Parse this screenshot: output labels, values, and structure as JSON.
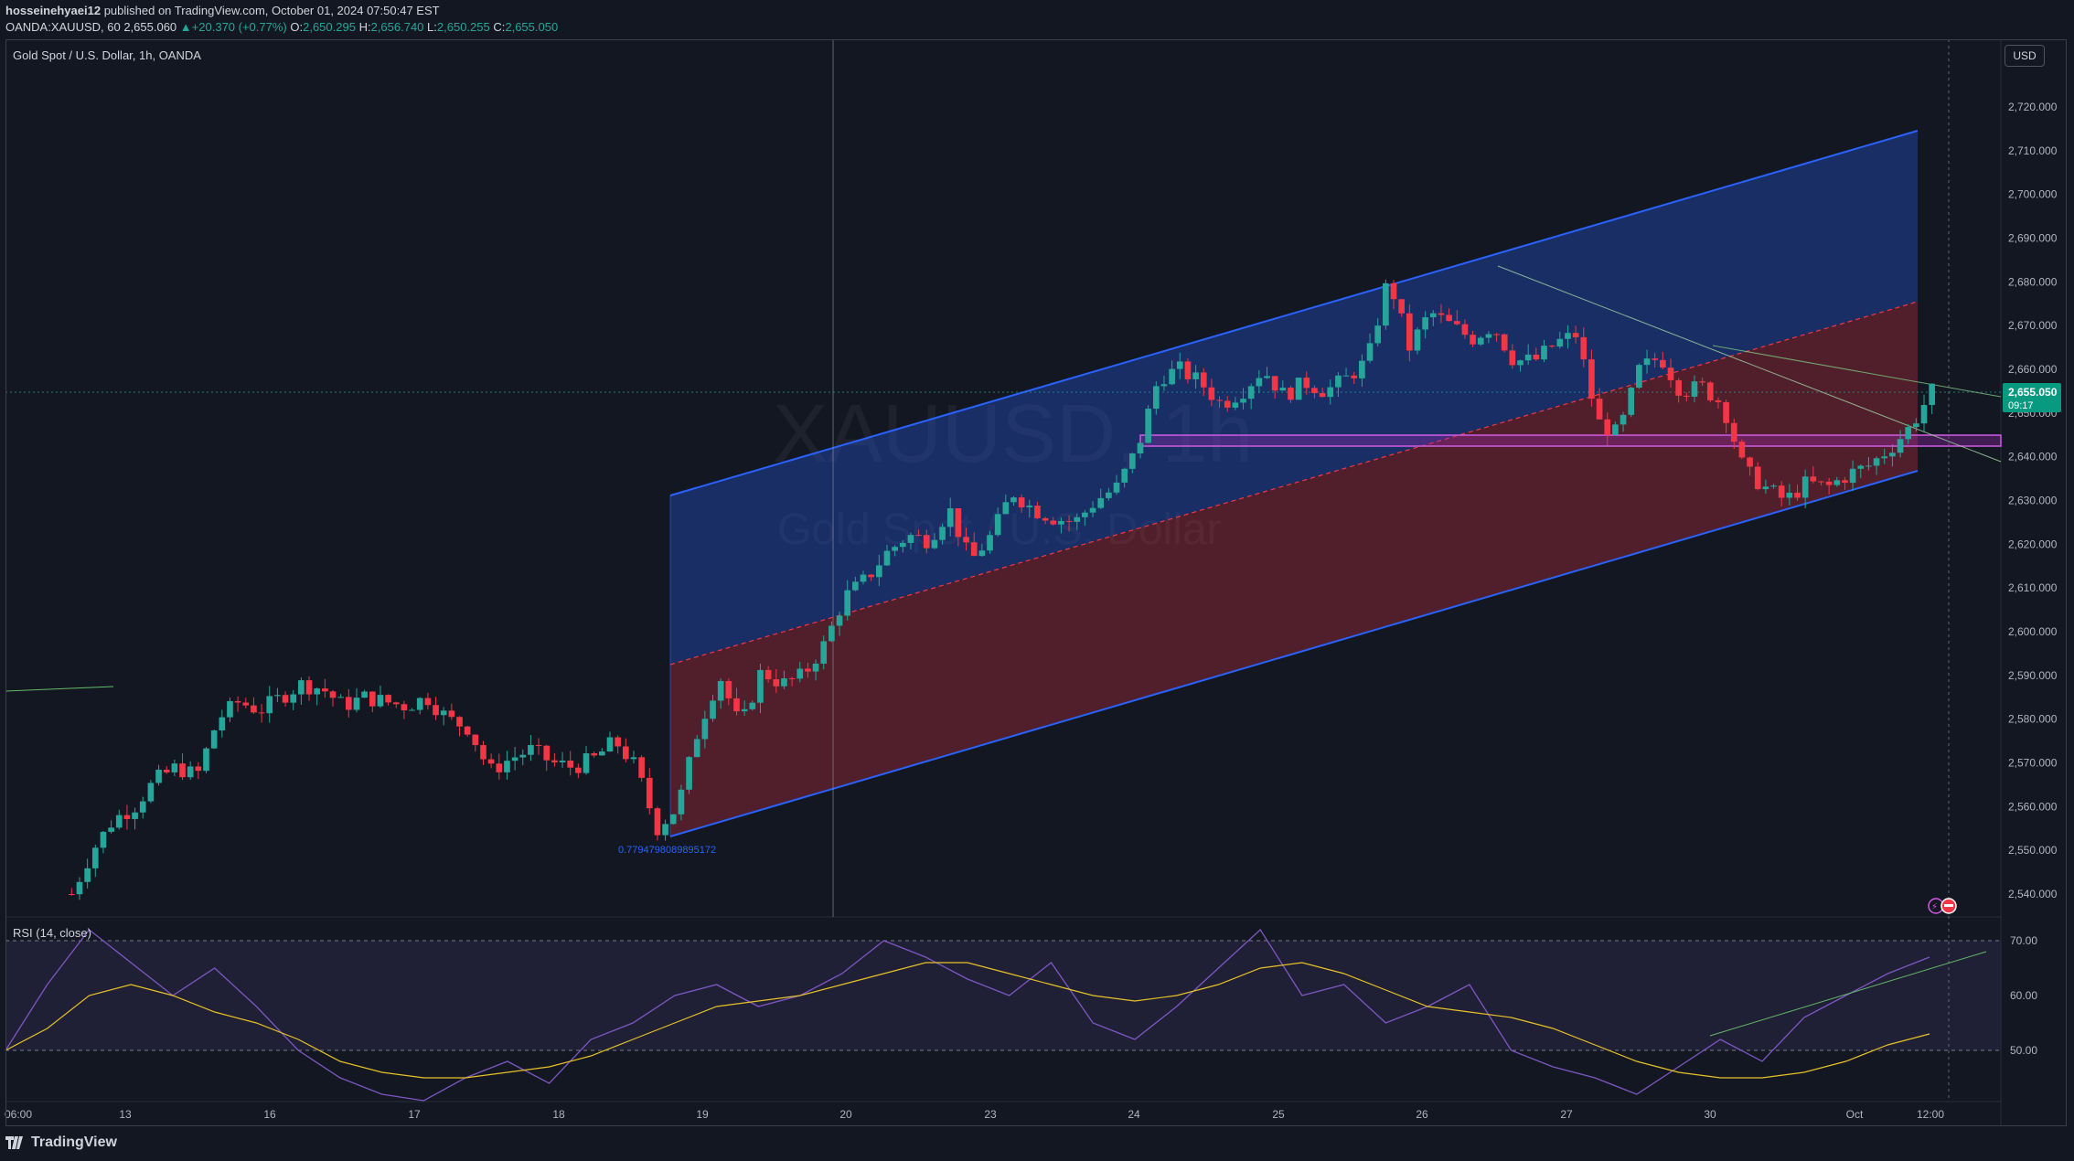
{
  "header": {
    "username": "hosseinehyaei12",
    "published_text": "published on TradingView.com, October 01, 2024 07:50:47 EST",
    "symbol": "OANDA:XAUUSD, 60",
    "last_price": "2,655.060",
    "change_arrow": "▲",
    "change": "+20.370 (+0.77%)",
    "open_label": "O:",
    "open": "2,650.295",
    "high_label": "H:",
    "high": "2,656.740",
    "low_label": "L:",
    "low": "2,650.255",
    "close_label": "C:",
    "close": "2,655.050"
  },
  "legend": {
    "title": "Gold Spot / U.S. Dollar, 1h, OANDA"
  },
  "currency_button": "USD",
  "watermark": {
    "symbol": "XAUUSD, 1h",
    "name": "Gold Spot / U.S. Dollar"
  },
  "price_tag": {
    "value": "2,655.050",
    "countdown": "09:17",
    "color": "#089981"
  },
  "regression_label": "0.7794798089895172",
  "rsi": {
    "label": "RSI (14, close)",
    "levels": [
      "70.00",
      "60.00",
      "50.00"
    ]
  },
  "brand": "TradingView",
  "colors": {
    "background": "#131722",
    "up_candle": "#26a69a",
    "down_candle": "#f23645",
    "channel_line": "#2962ff",
    "upper_fill": "#1e3a8a",
    "lower_fill": "#7f1d2d",
    "zone": "#9c27b0",
    "rsi_line": "#7e57c2",
    "rsi_ma": "#e6c229"
  },
  "chart_data": [
    {
      "type": "candlestick",
      "title": "Gold Spot / U.S. Dollar, 1h, OANDA",
      "price_axis": [
        "2,720.000",
        "2,710.000",
        "2,700.000",
        "2,690.000",
        "2,680.000",
        "2,670.000",
        "2,660.000",
        "2,650.000",
        "2,640.000",
        "2,630.000",
        "2,620.000",
        "2,610.000",
        "2,600.000",
        "2,590.000",
        "2,580.000",
        "2,570.000",
        "2,560.000",
        "2,550.000",
        "2,540.000"
      ],
      "ylim": [
        2536,
        2731
      ],
      "time_axis": [
        "06:00",
        "13",
        "16",
        "17",
        "18",
        "19",
        "20",
        "23",
        "24",
        "25",
        "26",
        "27",
        "30",
        "Oct",
        "12:00"
      ],
      "series": [
        {
          "name": "XAUUSD",
          "close_path": [
            [
              0,
              2540
            ],
            [
              2,
              2550
            ],
            [
              4,
              2557
            ],
            [
              6,
              2560
            ],
            [
              8,
              2566
            ],
            [
              10,
              2569
            ],
            [
              12,
              2567
            ],
            [
              14,
              2580
            ],
            [
              16,
              2584
            ],
            [
              18,
              2582
            ],
            [
              20,
              2585
            ],
            [
              22,
              2588
            ],
            [
              24,
              2587
            ],
            [
              26,
              2583
            ],
            [
              28,
              2585
            ],
            [
              30,
              2584
            ],
            [
              32,
              2583
            ],
            [
              34,
              2585
            ],
            [
              36,
              2580
            ],
            [
              38,
              2578
            ],
            [
              40,
              2568
            ],
            [
              42,
              2571
            ],
            [
              44,
              2573
            ],
            [
              46,
              2570
            ],
            [
              48,
              2569
            ],
            [
              50,
              2571
            ],
            [
              52,
              2575
            ],
            [
              54,
              2569
            ],
            [
              56,
              2555
            ],
            [
              58,
              2560
            ],
            [
              60,
              2578
            ],
            [
              62,
              2590
            ],
            [
              64,
              2578
            ],
            [
              66,
              2591
            ],
            [
              68,
              2588
            ],
            [
              70,
              2590
            ],
            [
              72,
              2597
            ],
            [
              74,
              2608
            ],
            [
              76,
              2612
            ],
            [
              78,
              2618
            ],
            [
              80,
              2622
            ],
            [
              82,
              2621
            ],
            [
              84,
              2628
            ],
            [
              86,
              2616
            ],
            [
              88,
              2622
            ],
            [
              90,
              2632
            ],
            [
              92,
              2628
            ],
            [
              94,
              2626
            ],
            [
              96,
              2625
            ],
            [
              98,
              2630
            ],
            [
              100,
              2633
            ],
            [
              102,
              2642
            ],
            [
              104,
              2658
            ],
            [
              106,
              2660
            ],
            [
              108,
              2657
            ],
            [
              110,
              2652
            ],
            [
              112,
              2655
            ],
            [
              114,
              2660
            ],
            [
              116,
              2654
            ],
            [
              118,
              2657
            ],
            [
              120,
              2655
            ],
            [
              122,
              2658
            ],
            [
              124,
              2662
            ],
            [
              126,
              2681
            ],
            [
              128,
              2665
            ],
            [
              130,
              2673
            ],
            [
              132,
              2670
            ],
            [
              134,
              2667
            ],
            [
              136,
              2670
            ],
            [
              138,
              2662
            ],
            [
              140,
              2662
            ],
            [
              142,
              2666
            ],
            [
              144,
              2668
            ],
            [
              146,
              2648
            ],
            [
              148,
              2645
            ],
            [
              150,
              2660
            ],
            [
              152,
              2663
            ],
            [
              154,
              2655
            ],
            [
              156,
              2656
            ],
            [
              158,
              2652
            ],
            [
              160,
              2637
            ],
            [
              162,
              2633
            ],
            [
              164,
              2630
            ],
            [
              166,
              2634
            ],
            [
              168,
              2633
            ],
            [
              170,
              2636
            ],
            [
              172,
              2638
            ],
            [
              174,
              2642
            ],
            [
              176,
              2647
            ],
            [
              178,
              2655
            ]
          ]
        }
      ],
      "annotations": [
        "Regression trend channel (upper: 2,631 to 2,715, mid dashed, lower: 2,553 to 2,637)",
        "Horizontal zone ~2,642 to 2,645",
        "Trend lines from 2,685 and 2,666 highs",
        "Last price 2,655.050"
      ]
    },
    {
      "type": "line",
      "title": "RSI (14, close)",
      "ylim": [
        37,
        73
      ],
      "levels": [
        70,
        60,
        50
      ],
      "series": [
        {
          "name": "RSI",
          "values": [
            50,
            62,
            72,
            66,
            60,
            65,
            58,
            50,
            45,
            42,
            40,
            45,
            48,
            44,
            52,
            55,
            60,
            62,
            58,
            60,
            64,
            70,
            67,
            63,
            60,
            66,
            55,
            52,
            58,
            65,
            72,
            60,
            62,
            55,
            58,
            62,
            50,
            47,
            45,
            42,
            47,
            52,
            48,
            56,
            60,
            64,
            67
          ]
        },
        {
          "name": "MA",
          "values": [
            50,
            54,
            60,
            62,
            60,
            57,
            55,
            52,
            48,
            46,
            45,
            45,
            46,
            47,
            49,
            52,
            55,
            58,
            59,
            60,
            62,
            64,
            66,
            66,
            64,
            62,
            60,
            59,
            60,
            62,
            65,
            66,
            64,
            61,
            58,
            57,
            56,
            54,
            51,
            48,
            46,
            45,
            45,
            46,
            48,
            51,
            53
          ]
        }
      ]
    }
  ]
}
